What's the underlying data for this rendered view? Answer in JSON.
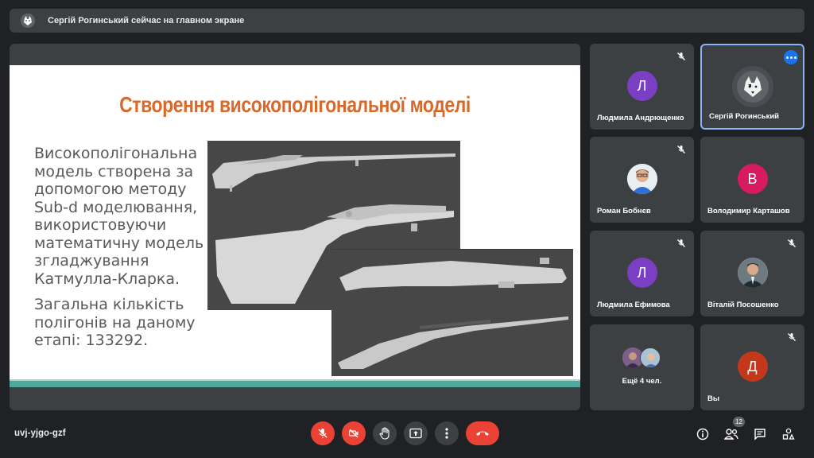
{
  "banner": {
    "text": "Сергій Рогинський сейчас на главном экране"
  },
  "slide": {
    "title": "Створення високополігональної моделі",
    "paragraph1": "Високополігональна модель створена за допомогою методу Sub-d моделювання, використовуючи математичну модель згладжування Катмулла-Кларка.",
    "paragraph2": "Загальна кількість полігонів на даному етапі: 133292."
  },
  "participants": [
    {
      "name": "Людмила Андрющенко",
      "initial": "Л",
      "color": "#7b3fc4",
      "muted": true
    },
    {
      "name": "Сергій Рогинський",
      "initial": "",
      "color": "#5f6368",
      "muted": false,
      "speaking": true
    },
    {
      "name": "Роман Бобнєв",
      "initial": "",
      "color": "#e8eaed",
      "muted": true
    },
    {
      "name": "Володимир Карташов",
      "initial": "В",
      "color": "#d81b60",
      "muted": false
    },
    {
      "name": "Людмила Ефимова",
      "initial": "Л",
      "color": "#7b3fc4",
      "muted": true
    },
    {
      "name": "Віталій Посошенко",
      "initial": "",
      "color": "#cfd8dc",
      "muted": true
    },
    {
      "name": "Ещё 4 чел.",
      "initial": "",
      "color": "",
      "muted": false
    },
    {
      "name": "Вы",
      "initial": "Д",
      "color": "#c5371a",
      "muted": true
    }
  ],
  "meeting_code": "uvj-yjgo-gzf",
  "people_count": "12",
  "colors": {
    "accent": "#8ab4f8",
    "danger": "#ea4335",
    "slide_title": "#d9692a",
    "slide_footer": "#4fa89b"
  },
  "icons": {
    "mic": "mic-off-icon",
    "cam": "videocam-off-icon",
    "hand": "raise-hand-icon",
    "present": "present-icon",
    "more": "more-vert-icon",
    "leave": "call-end-icon",
    "info": "info-icon",
    "people": "people-icon",
    "chat": "chat-icon",
    "activities": "activities-icon"
  }
}
